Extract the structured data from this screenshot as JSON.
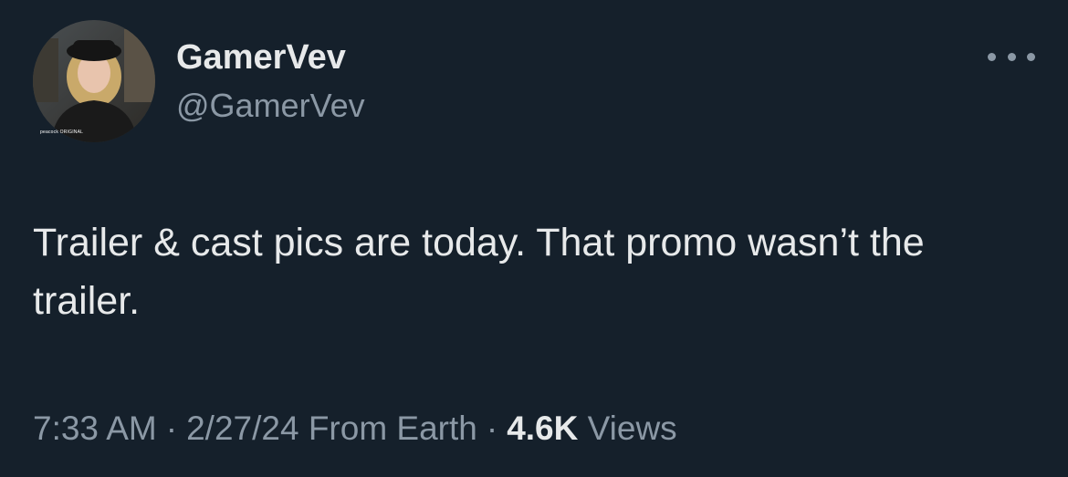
{
  "author": {
    "display_name": "GamerVev",
    "handle": "@GamerVev",
    "avatar_badge": "peacock ORIGINAL"
  },
  "tweet": {
    "text": "Trailer & cast pics are today. That promo wasn’t the trailer."
  },
  "meta": {
    "time": "7:33 AM",
    "separator": "·",
    "date": "2/27/24",
    "location": "From Earth",
    "views_count": "4.6K",
    "views_label": "Views"
  },
  "icons": {
    "more": "more-options-icon"
  },
  "colors": {
    "background": "#15202b",
    "primary_text": "#e7e9ea",
    "secondary_text": "#8b98a5"
  }
}
